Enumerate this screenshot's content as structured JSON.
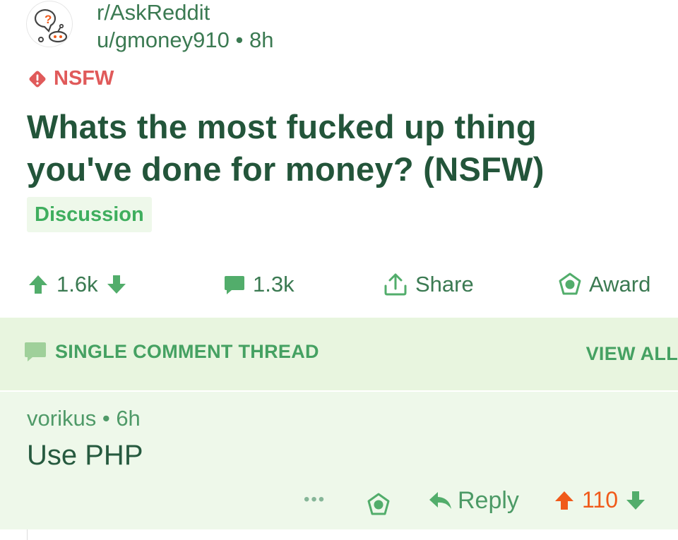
{
  "post": {
    "subreddit": "r/AskReddit",
    "author": "u/gmoney910",
    "separator": "•",
    "age": "8h",
    "nsfw_label": "NSFW",
    "title": "Whats the most fucked up thing you've done for money? (NSFW)",
    "flair": "Discussion",
    "icons": {
      "avatar": "askreddit-snoo-icon",
      "nsfw": "warning-diamond-icon",
      "upvote": "arrow-up-icon",
      "downvote": "arrow-down-icon",
      "comments": "comment-bubble-icon",
      "share": "share-upload-icon",
      "award": "award-badge-icon"
    },
    "actions": {
      "votes": "1.6k",
      "comments": "1.3k",
      "share": "Share",
      "award": "Award"
    }
  },
  "thread": {
    "title": "SINGLE COMMENT THREAD",
    "view_all": "VIEW ALL"
  },
  "comment": {
    "author": "vorikus",
    "separator": "•",
    "age": "6h",
    "body": "Use PHP",
    "more": "•••",
    "reply": "Reply",
    "score": "110"
  },
  "colors": {
    "primary_text": "#23553a",
    "accent_green": "#45a162",
    "upvoted_orange": "#f05a1a",
    "nsfw_red": "#e05a5a",
    "thread_header_bg": "#e8f5df",
    "comment_bg": "#eef8ea"
  }
}
